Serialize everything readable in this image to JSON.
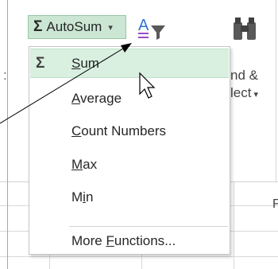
{
  "ribbon": {
    "autosum": {
      "symbol": "Σ",
      "label": "AutoSum",
      "caret": "▾"
    },
    "find_select": {
      "line1": "nd &",
      "line2": "lect",
      "caret": "▾"
    },
    "colors": {
      "button_green": "#cbe6d2",
      "hover_green": "#d9efe0",
      "accent_blue": "#2e75d6",
      "accent_purple": "#9a4cc7"
    }
  },
  "menu": {
    "items": [
      {
        "glyph": "Σ",
        "label_pre": "",
        "label_key": "S",
        "label_post": "um"
      },
      {
        "glyph": "",
        "label_pre": "",
        "label_key": "A",
        "label_post": "verage"
      },
      {
        "glyph": "",
        "label_pre": "",
        "label_key": "C",
        "label_post": "ount Numbers"
      },
      {
        "glyph": "",
        "label_pre": "",
        "label_key": "M",
        "label_post": "ax"
      },
      {
        "glyph": "",
        "label_pre": "M",
        "label_key": "i",
        "label_post": "n"
      },
      {
        "glyph": "",
        "label_pre": "More ",
        "label_key": "F",
        "label_post": "unctions..."
      }
    ]
  },
  "sheet": {
    "edge_letter": "F"
  },
  "icons": {
    "autosum": "sigma-icon",
    "sort_filter": "sort-filter-icon",
    "find_select": "binoculars-icon",
    "cursor": "mouse-pointer-icon"
  }
}
